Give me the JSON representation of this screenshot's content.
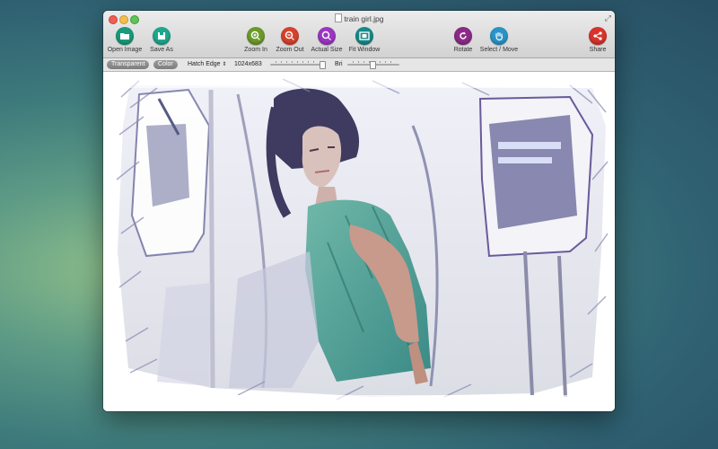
{
  "window": {
    "title": "train girl.jpg"
  },
  "toolbar": {
    "open_image": "Open Image",
    "save_as": "Save As",
    "zoom_in": "Zoom In",
    "zoom_out": "Zoom Out",
    "actual_size": "Actual Size",
    "fit_window": "Fit Window",
    "rotate": "Rotate",
    "select_move": "Select / Move",
    "share": "Share"
  },
  "options": {
    "transparent": "Transparent",
    "color": "Color",
    "effect": "Hatch Edge",
    "dimensions": "1024x683",
    "brightness_label": "Bri"
  },
  "colors": {
    "open_image": "#1a9a7a",
    "save_as": "#1ea88c",
    "zoom_in": "#6b9a2a",
    "zoom_out": "#d6422c",
    "actual_size": "#9b37c2",
    "fit_window": "#178a88",
    "rotate": "#8c2a88",
    "select_move": "#2a94c8",
    "share": "#d8342c"
  },
  "icons": {
    "open_image": "folder-icon",
    "save_as": "save-icon",
    "zoom_in": "zoom-in-icon",
    "zoom_out": "zoom-out-icon",
    "actual_size": "actual-size-icon",
    "fit_window": "fit-window-icon",
    "rotate": "rotate-icon",
    "select_move": "hand-icon",
    "share": "share-icon"
  }
}
